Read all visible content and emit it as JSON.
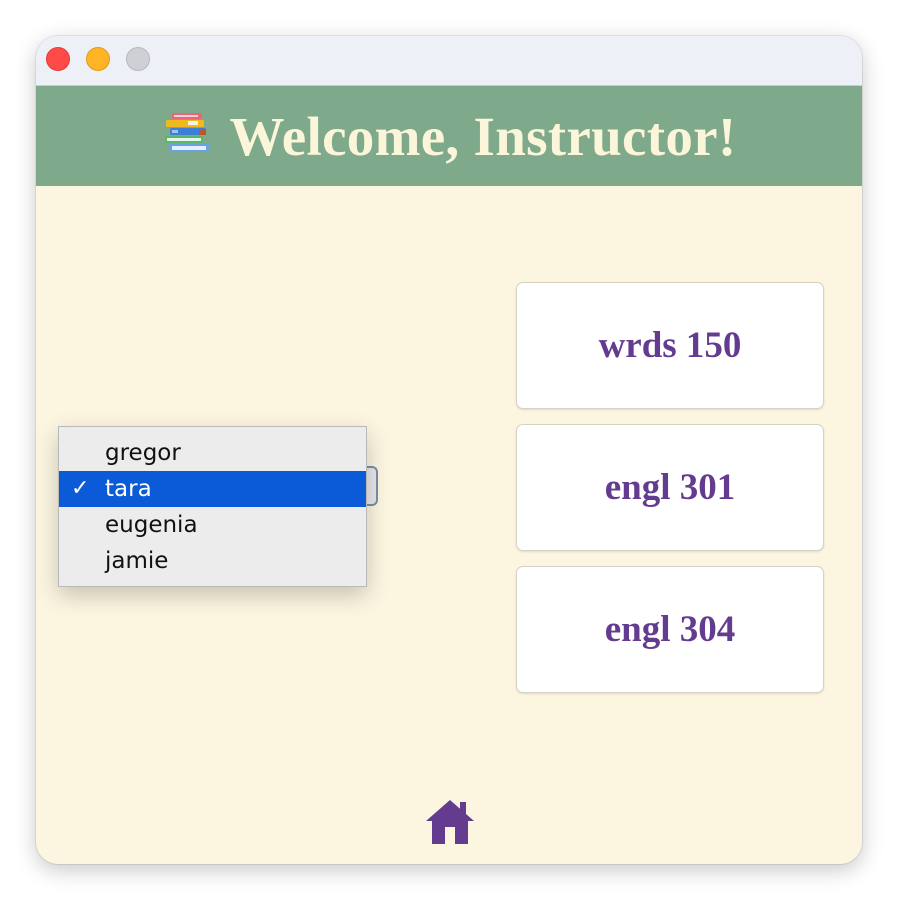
{
  "header": {
    "title": "Welcome, Instructor!",
    "icon": "books-icon"
  },
  "courses": [
    {
      "label": "wrds 150"
    },
    {
      "label": "engl 301"
    },
    {
      "label": "engl 304"
    }
  ],
  "student_select": {
    "options": [
      "gregor",
      "tara",
      "eugenia",
      "jamie"
    ],
    "selected": "tara",
    "check_mark": "✓"
  },
  "footer": {
    "icon": "home-icon"
  },
  "colors": {
    "header_bg": "#7ea98b",
    "header_text": "#fbf5da",
    "page_bg": "#fcf6e1",
    "course_text": "#643c8f",
    "selection": "#0b5bd8",
    "home_icon": "#643c8f"
  }
}
